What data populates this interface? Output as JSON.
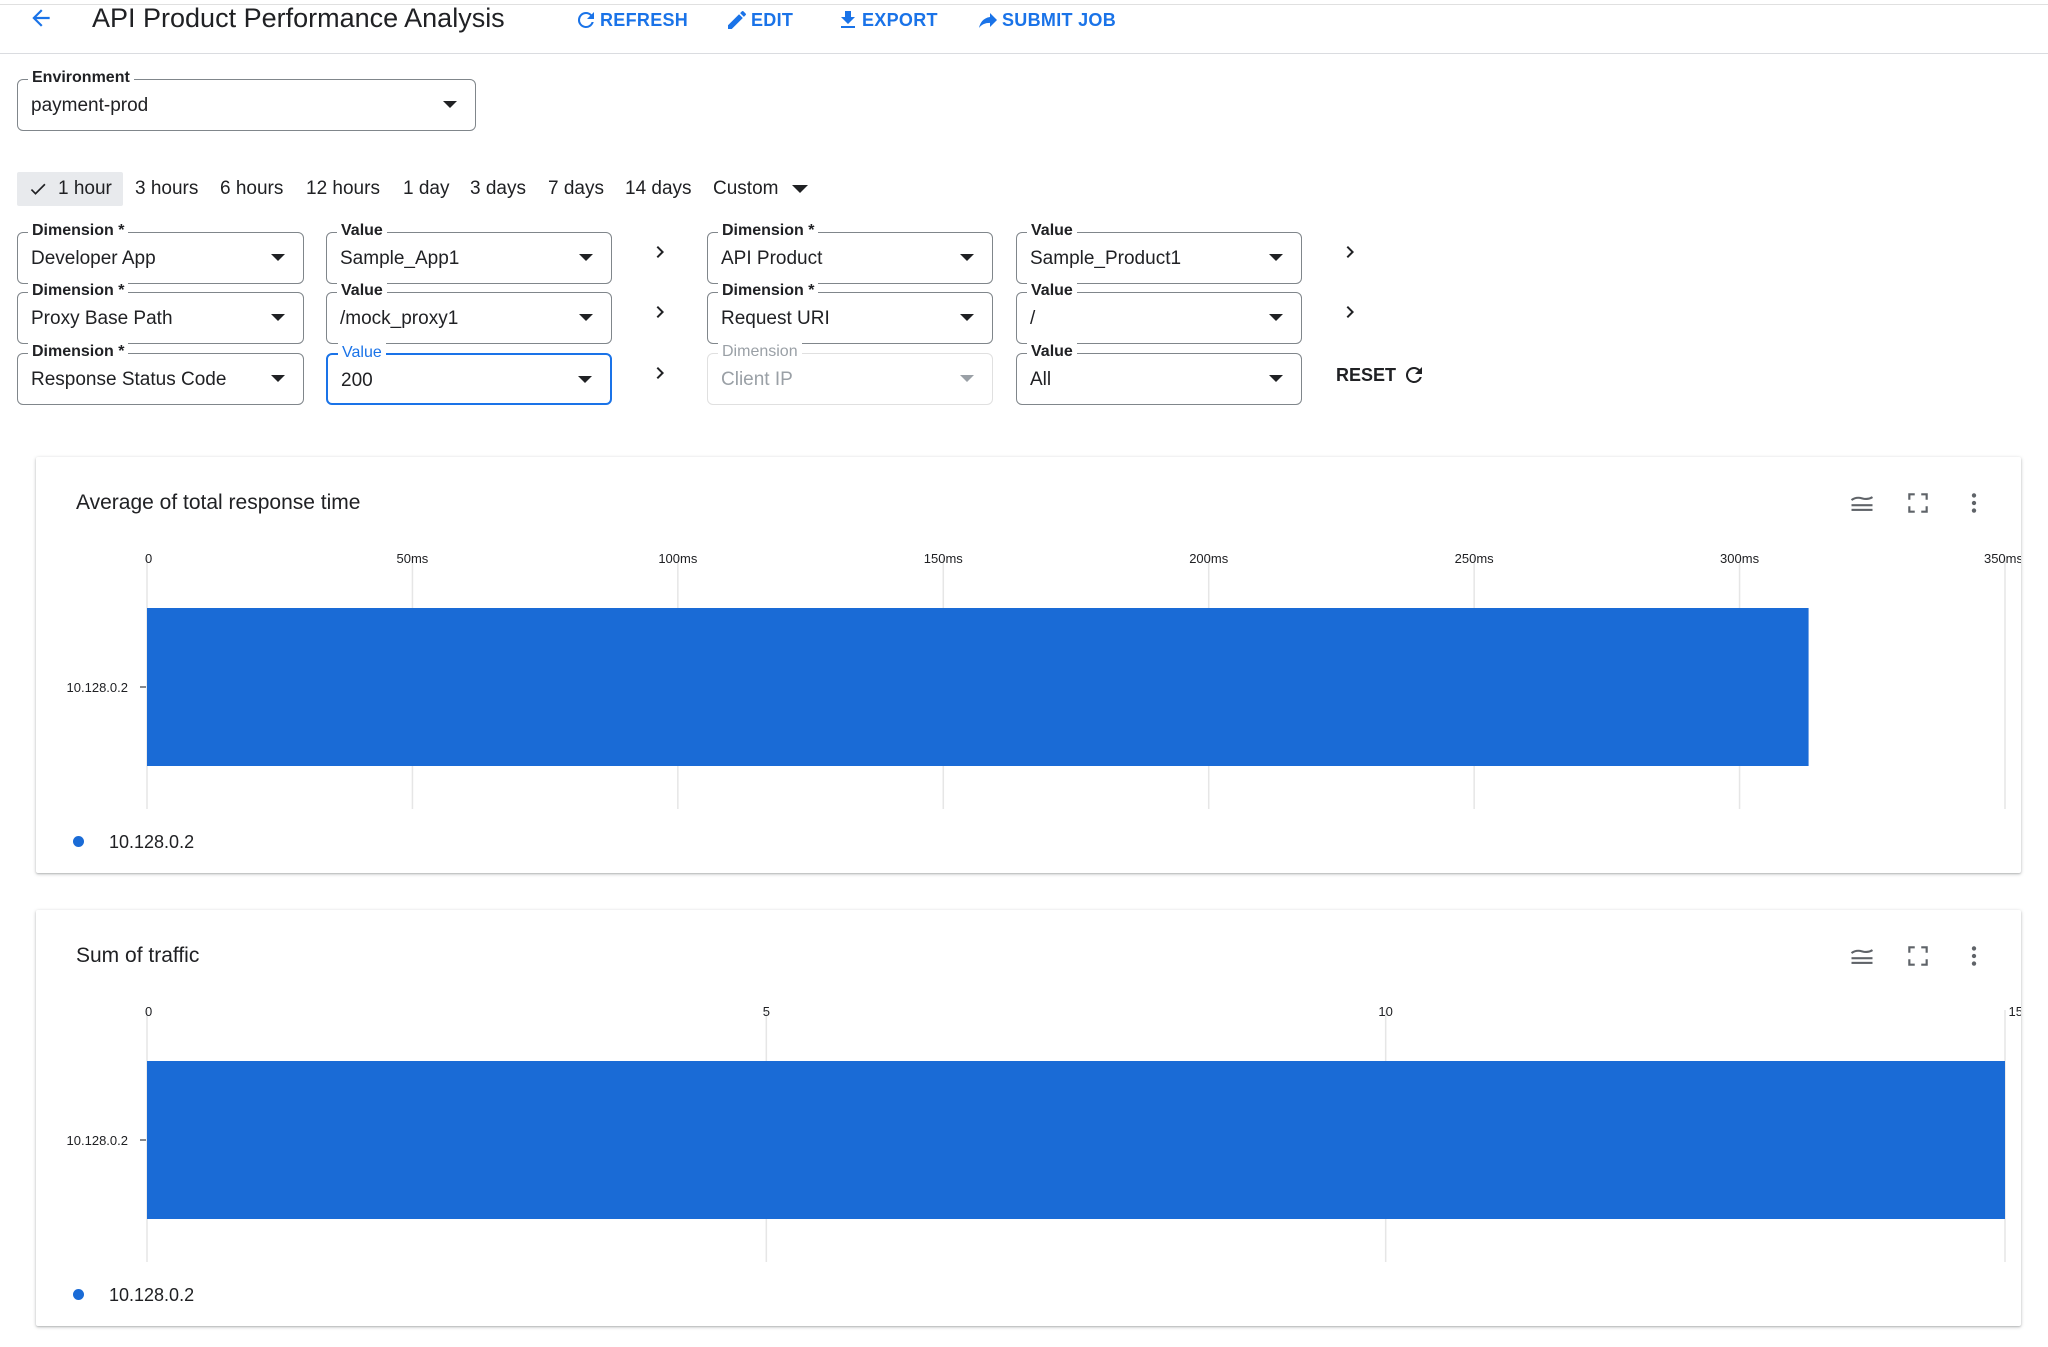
{
  "header": {
    "title": "API Product Performance Analysis",
    "actions": {
      "refresh": "REFRESH",
      "edit": "EDIT",
      "export": "EXPORT",
      "submit_job": "SUBMIT JOB"
    }
  },
  "environment": {
    "label": "Environment",
    "value": "payment-prod"
  },
  "time_ranges": {
    "selected": "1 hour",
    "options": [
      "1 hour",
      "3 hours",
      "6 hours",
      "12 hours",
      "1 day",
      "3 days",
      "7 days",
      "14 days",
      "Custom"
    ]
  },
  "filters": {
    "row1": {
      "dim1": {
        "label": "Dimension *",
        "value": "Developer App"
      },
      "val1": {
        "label": "Value",
        "value": "Sample_App1"
      },
      "dim2": {
        "label": "Dimension *",
        "value": "API Product"
      },
      "val2": {
        "label": "Value",
        "value": "Sample_Product1"
      }
    },
    "row2": {
      "dim1": {
        "label": "Dimension *",
        "value": "Proxy Base Path"
      },
      "val1": {
        "label": "Value",
        "value": "/mock_proxy1"
      },
      "dim2": {
        "label": "Dimension *",
        "value": "Request URI"
      },
      "val2": {
        "label": "Value",
        "value": "/"
      }
    },
    "row3": {
      "dim1": {
        "label": "Dimension *",
        "value": "Response Status Code"
      },
      "val1": {
        "label": "Value",
        "value": "200"
      },
      "dim2": {
        "label": "Dimension",
        "value": "Client IP"
      },
      "val2": {
        "label": "Value",
        "value": "All"
      }
    },
    "reset_label": "RESET"
  },
  "colors": {
    "accent": "#1a73e8",
    "bar": "#1a6bd6"
  },
  "chart_data": [
    {
      "type": "bar",
      "orientation": "horizontal",
      "title": "Average of total response time",
      "categories": [
        "10.128.0.2"
      ],
      "series": [
        {
          "name": "10.128.0.2",
          "values": [
            313
          ]
        }
      ],
      "xlim": [
        0,
        350
      ],
      "xticks": [
        "0",
        "50ms",
        "100ms",
        "150ms",
        "200ms",
        "250ms",
        "300ms",
        "350ms"
      ],
      "grid": true,
      "legend": "bottom-left",
      "legend_label": "10.128.0.2"
    },
    {
      "type": "bar",
      "orientation": "horizontal",
      "title": "Sum of traffic",
      "categories": [
        "10.128.0.2"
      ],
      "series": [
        {
          "name": "10.128.0.2",
          "values": [
            15
          ]
        }
      ],
      "xlim": [
        0,
        15
      ],
      "xticks": [
        "0",
        "5",
        "10",
        "15"
      ],
      "grid": true,
      "legend": "bottom-left",
      "legend_label": "10.128.0.2"
    }
  ]
}
